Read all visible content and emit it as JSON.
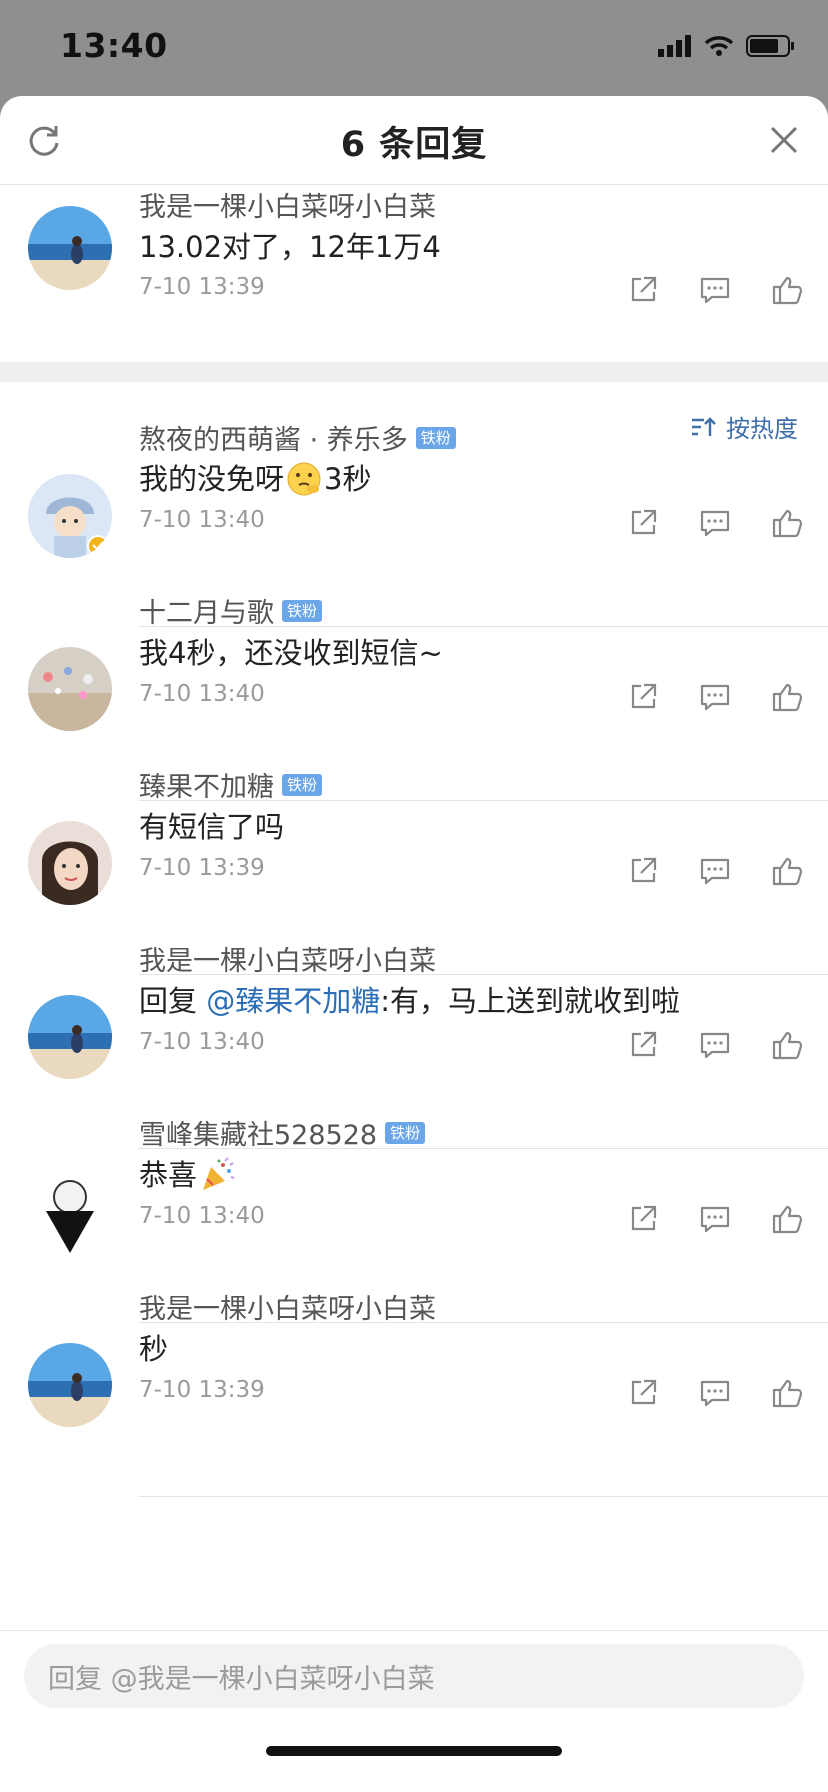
{
  "status_bar": {
    "time": "13:40"
  },
  "header": {
    "title": "6 条回复",
    "refresh_icon": "refresh-icon",
    "close_icon": "close-icon"
  },
  "main_post": {
    "user": "我是一棵小白菜呀小白菜",
    "text": "13.02对了，12年1万4",
    "time": "7-10 13:39"
  },
  "sort": {
    "label": "按热度",
    "icon": "sort-icon"
  },
  "replies": [
    {
      "user": "熬夜的西萌酱 · 养乐多",
      "badge": "铁粉",
      "text_before": "我的没免呀",
      "emoji": "thinking-emoji",
      "text_after": "3秒",
      "time": "7-10 13:40"
    },
    {
      "user": "十二月与歌",
      "badge": "铁粉",
      "text": "我4秒，还没收到短信~",
      "time": "7-10 13:40"
    },
    {
      "user": "臻果不加糖",
      "badge": "铁粉",
      "text": "有短信了吗",
      "time": "7-10 13:39"
    },
    {
      "user": "我是一棵小白菜呀小白菜",
      "prefix": "回复 ",
      "mention": "@臻果不加糖",
      "text": ":有，马上送到就收到啦",
      "time": "7-10 13:40"
    },
    {
      "user": "雪峰集藏社528528",
      "badge": "铁粉",
      "text": "恭喜",
      "emoji": "party-popper-emoji",
      "time": "7-10 13:40"
    },
    {
      "user": "我是一棵小白菜呀小白菜",
      "text": "秒",
      "time": "7-10 13:39"
    }
  ],
  "composer": {
    "placeholder": "回复 @我是一棵小白菜呀小白菜"
  },
  "colors": {
    "accent": "#3f6fa8",
    "badge": "#6aa6e8",
    "time": "#9a9a9a"
  }
}
